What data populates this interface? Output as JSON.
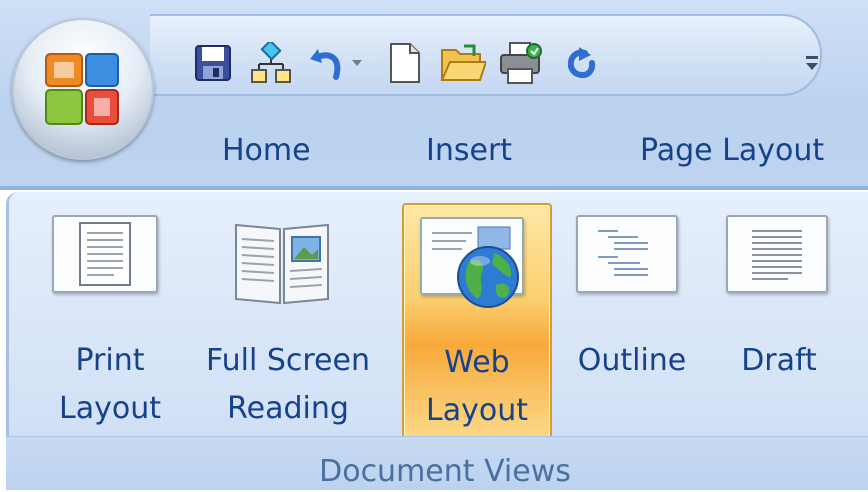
{
  "tabs": [
    {
      "label": "Home"
    },
    {
      "label": "Insert"
    },
    {
      "label": "Page Layout"
    }
  ],
  "quick_access": {
    "icons": [
      "save-icon",
      "organization-chart-icon",
      "undo-icon",
      "undo-dropdown-icon",
      "new-document-icon",
      "open-folder-icon",
      "print-preview-icon",
      "redo-icon",
      "customize-dropdown-icon"
    ]
  },
  "group": {
    "label": "Document Views",
    "buttons": [
      {
        "line1": "Print",
        "line2": "Layout",
        "icon": "print-layout-icon",
        "active": false
      },
      {
        "line1": "Full Screen",
        "line2": "Reading",
        "icon": "full-screen-reading-icon",
        "active": false
      },
      {
        "line1": "Web",
        "line2": "Layout",
        "icon": "web-layout-icon",
        "active": true
      },
      {
        "line1": "Outline",
        "line2": "",
        "icon": "outline-icon",
        "active": false
      },
      {
        "line1": "Draft",
        "line2": "",
        "icon": "draft-icon",
        "active": false
      }
    ]
  },
  "colors": {
    "tab_text": "#15428b",
    "group_label_text": "#4a6fa1",
    "ribbon_background": "#d6e4f7",
    "active_highlight": "#fbd070"
  }
}
